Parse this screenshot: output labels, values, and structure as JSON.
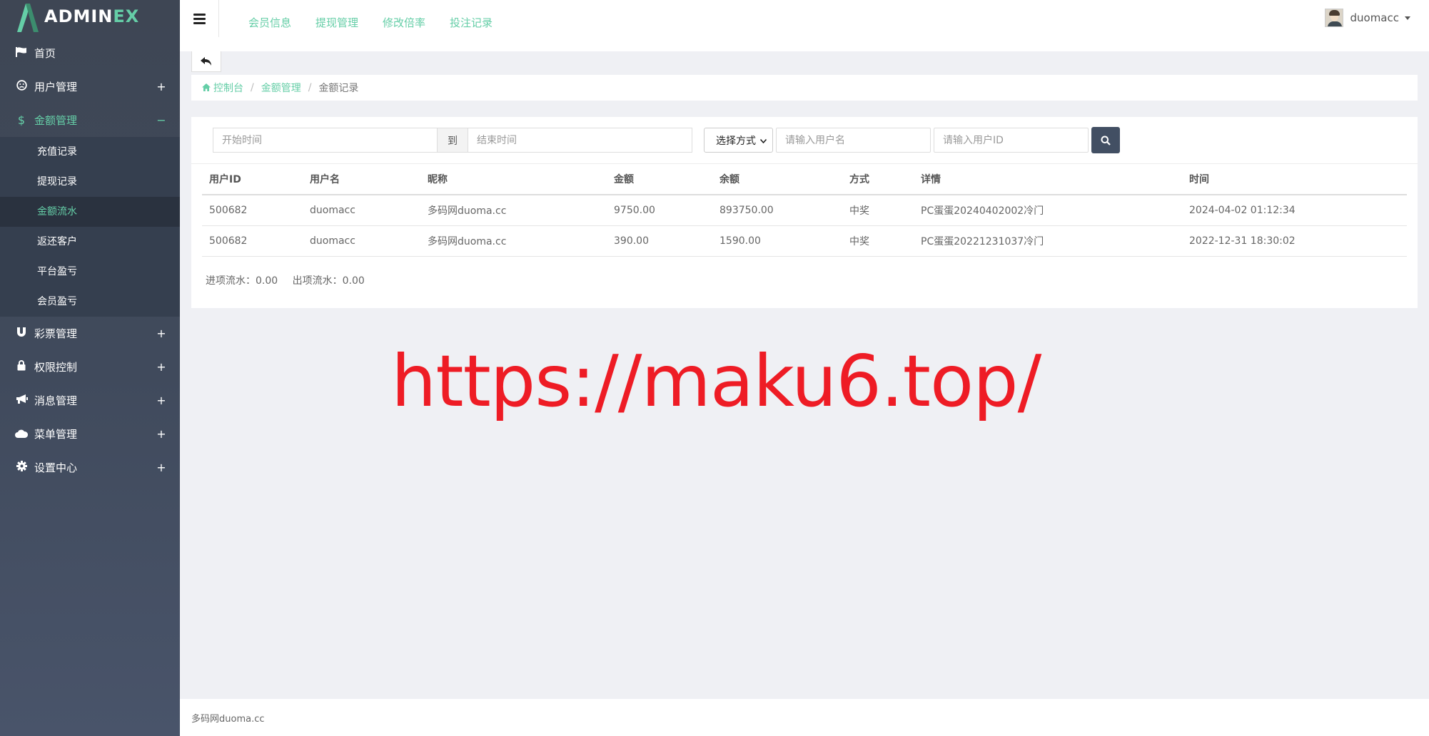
{
  "brand": {
    "logo_main": "ADMIN",
    "logo_accent": "EX"
  },
  "sidebar": {
    "items": [
      {
        "label": "首页",
        "icon": "flag-icon"
      },
      {
        "label": "用户管理",
        "icon": "user-circle-icon",
        "toggle": "+"
      },
      {
        "label": "金额管理",
        "icon": "dollar-icon",
        "toggle": "−",
        "children": [
          {
            "label": "充值记录"
          },
          {
            "label": "提现记录"
          },
          {
            "label": "金额流水"
          },
          {
            "label": "返还客户"
          },
          {
            "label": "平台盈亏"
          },
          {
            "label": "会员盈亏"
          }
        ]
      },
      {
        "label": "彩票管理",
        "icon": "magnet-icon",
        "toggle": "+"
      },
      {
        "label": "权限控制",
        "icon": "lock-icon",
        "toggle": "+"
      },
      {
        "label": "消息管理",
        "icon": "bullhorn-icon",
        "toggle": "+"
      },
      {
        "label": "菜单管理",
        "icon": "cloud-icon",
        "toggle": "+"
      },
      {
        "label": "设置中心",
        "icon": "gear-icon",
        "toggle": "+"
      }
    ]
  },
  "header": {
    "links": [
      "会员信息",
      "提现管理",
      "修改倍率",
      "投注记录"
    ],
    "username": "duomacc"
  },
  "breadcrumb": {
    "home": "控制台",
    "section": "金额管理",
    "current": "金额记录"
  },
  "filters": {
    "start_placeholder": "开始时间",
    "to_label": "到",
    "end_placeholder": "结束时间",
    "method_select": "选择方式",
    "username_placeholder": "请输入用户名",
    "userid_placeholder": "请输入用户ID"
  },
  "table": {
    "headers": [
      "用户ID",
      "用户名",
      "昵称",
      "金额",
      "余额",
      "方式",
      "详情",
      "时间"
    ],
    "rows": [
      [
        "500682",
        "duomacc",
        "多码网duoma.cc",
        "9750.00",
        "893750.00",
        "中奖",
        "PC蛋蛋20240402002冷门",
        "2024-04-02 01:12:34"
      ],
      [
        "500682",
        "duomacc",
        "多码网duoma.cc",
        "390.00",
        "1590.00",
        "中奖",
        "PC蛋蛋20221231037冷门",
        "2022-12-31 18:30:02"
      ]
    ]
  },
  "summary": {
    "in_flow": "进项流水：0.00",
    "out_flow": "出项流水：0.00"
  },
  "watermark": "https://maku6.top/",
  "footer": "多码网duoma.cc",
  "colors": {
    "accent": "#65cea7",
    "sidebar": "#404a5c",
    "search_button": "#424f63",
    "watermark": "#ee1c25"
  }
}
